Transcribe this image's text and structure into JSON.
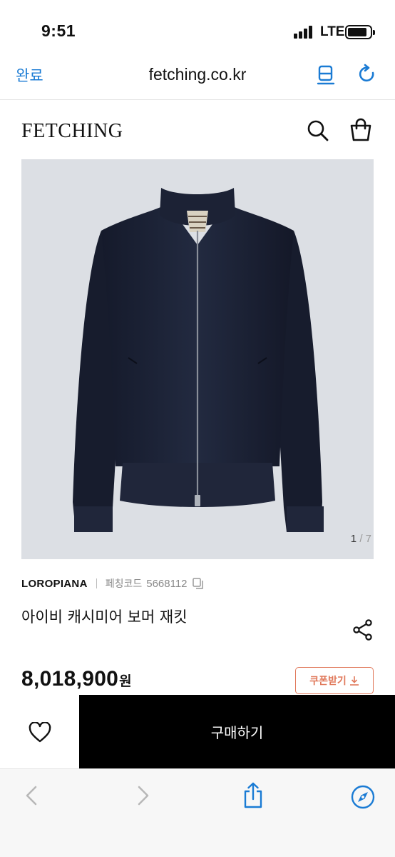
{
  "status_bar": {
    "time": "9:51",
    "network": "LTE"
  },
  "browser": {
    "done_label": "완료",
    "url": "fetching.co.kr",
    "accent_color": "#1a7bd4"
  },
  "site": {
    "logo": "FETCHING"
  },
  "gallery": {
    "current": "1",
    "total": "7",
    "separator": "/"
  },
  "product": {
    "brand": "LOROPIANA",
    "code_label": "페칭코드",
    "code": "5668112",
    "name": "아이비 캐시미어 보머 재킷",
    "price": "8,018,900",
    "price_unit": "원"
  },
  "coupon": {
    "label": "쿠폰받기",
    "color": "#e0785a"
  },
  "actions": {
    "buy_label": "구매하기"
  },
  "icons": {
    "header": [
      "search-icon",
      "shopping-bag-icon"
    ],
    "browser": [
      "reader-list-icon",
      "reload-icon"
    ],
    "toolbar": [
      "back-icon",
      "forward-icon",
      "share-icon",
      "compass-icon"
    ]
  }
}
